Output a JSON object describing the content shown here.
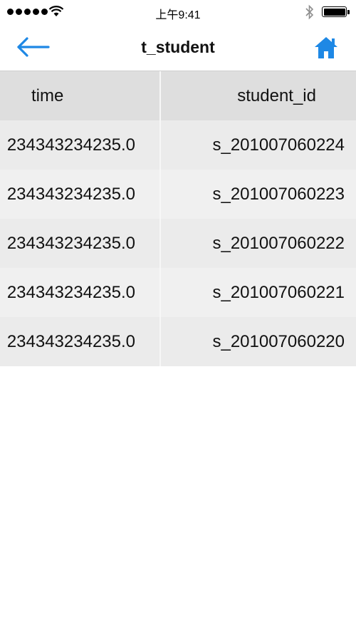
{
  "status_bar": {
    "time": "上午9:41",
    "signal_icon": "signal-dots-icon",
    "wifi_icon": "wifi-icon",
    "bluetooth_icon": "bluetooth-icon",
    "battery_icon": "battery-icon",
    "battery_level": 1.0
  },
  "nav": {
    "title": "t_student",
    "back_icon": "arrow-left-icon",
    "home_icon": "home-icon",
    "accent_color": "#1e88e5"
  },
  "table": {
    "columns": [
      "time",
      "student_id"
    ],
    "rows": [
      [
        "234343234235.0",
        "s_201007060224"
      ],
      [
        "234343234235.0",
        "s_201007060223"
      ],
      [
        "234343234235.0",
        "s_201007060222"
      ],
      [
        "234343234235.0",
        "s_201007060221"
      ],
      [
        "234343234235.0",
        "s_201007060220"
      ]
    ]
  }
}
